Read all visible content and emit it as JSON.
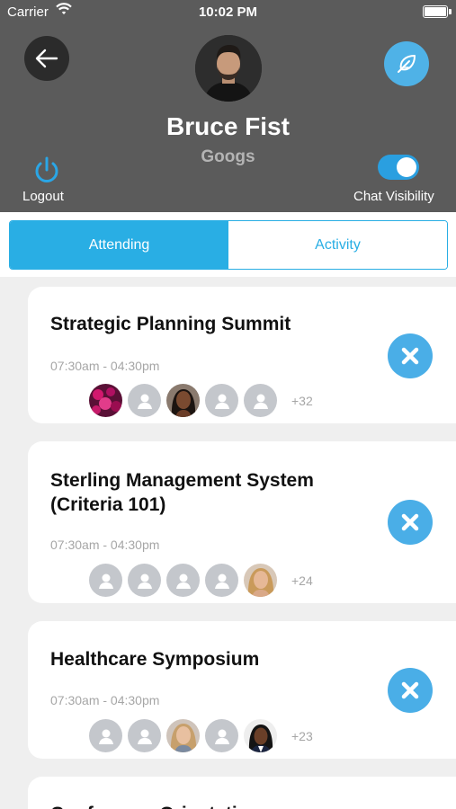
{
  "status_bar": {
    "carrier": "Carrier",
    "time": "10:02 PM"
  },
  "profile": {
    "name": "Bruce Fist",
    "organization": "Googs"
  },
  "actions": {
    "logout_label": "Logout",
    "chat_visibility_label": "Chat Visibility",
    "chat_visibility_on": true
  },
  "tabs": [
    {
      "label": "Attending",
      "active": true
    },
    {
      "label": "Activity",
      "active": false
    }
  ],
  "events": [
    {
      "title": "Strategic Planning Summit",
      "time": "07:30am - 04:30pm",
      "attendees": [
        "photo-flowers",
        "placeholder",
        "photo-woman",
        "placeholder",
        "placeholder"
      ],
      "more_count": "+32"
    },
    {
      "title": "Sterling Management System (Criteria 101)",
      "time": "07:30am - 04:30pm",
      "attendees": [
        "placeholder",
        "placeholder",
        "placeholder",
        "placeholder",
        "photo-blonde"
      ],
      "more_count": "+24"
    },
    {
      "title": "Healthcare Symposium",
      "time": "07:30am - 04:30pm",
      "attendees": [
        "placeholder",
        "placeholder",
        "photo-blonde",
        "placeholder",
        "photo-woman-2"
      ],
      "more_count": "+23"
    },
    {
      "title": "Conference Orientation",
      "time": "",
      "attendees": [],
      "more_count": ""
    }
  ],
  "colors": {
    "header_bg": "#5b5b5b",
    "accent": "#29aee4",
    "remove_button": "#4aaee7",
    "toggle_on": "#2a9fe0"
  }
}
